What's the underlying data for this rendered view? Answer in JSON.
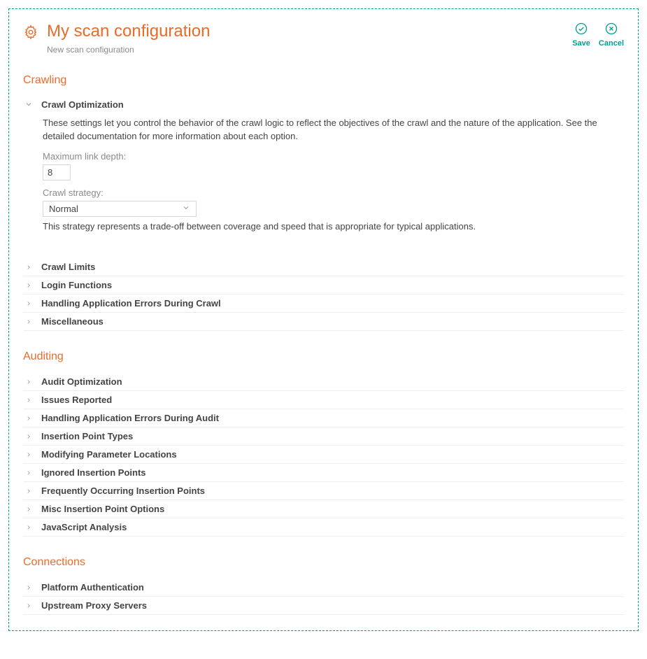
{
  "header": {
    "title": "My scan configuration",
    "subtitle": "New scan configuration"
  },
  "actions": {
    "save": "Save",
    "cancel": "Cancel"
  },
  "sections": {
    "crawling": {
      "title": "Crawling",
      "crawl_optimization": {
        "label": "Crawl Optimization",
        "description": "These settings let you control the behavior of the crawl logic to reflect the objectives of the crawl and the nature of the application. See the detailed documentation for more information about each option.",
        "max_link_depth_label": "Maximum link depth:",
        "max_link_depth_value": "8",
        "crawl_strategy_label": "Crawl strategy:",
        "crawl_strategy_value": "Normal",
        "crawl_strategy_description": "This strategy represents a trade-off between coverage and speed that is appropriate for typical applications."
      },
      "rows": {
        "crawl_limits": "Crawl Limits",
        "login_functions": "Login Functions",
        "errors_during_crawl": "Handling Application Errors During Crawl",
        "miscellaneous": "Miscellaneous"
      }
    },
    "auditing": {
      "title": "Auditing",
      "rows": {
        "audit_optimization": "Audit Optimization",
        "issues_reported": "Issues Reported",
        "errors_during_audit": "Handling Application Errors During Audit",
        "insertion_point_types": "Insertion Point Types",
        "modifying_parameter_locations": "Modifying Parameter Locations",
        "ignored_insertion_points": "Ignored Insertion Points",
        "frequently_occurring": "Frequently Occurring Insertion Points",
        "misc_insertion": "Misc Insertion Point Options",
        "javascript_analysis": "JavaScript Analysis"
      }
    },
    "connections": {
      "title": "Connections",
      "rows": {
        "platform_auth": "Platform Authentication",
        "upstream_proxy": "Upstream Proxy Servers"
      }
    }
  }
}
